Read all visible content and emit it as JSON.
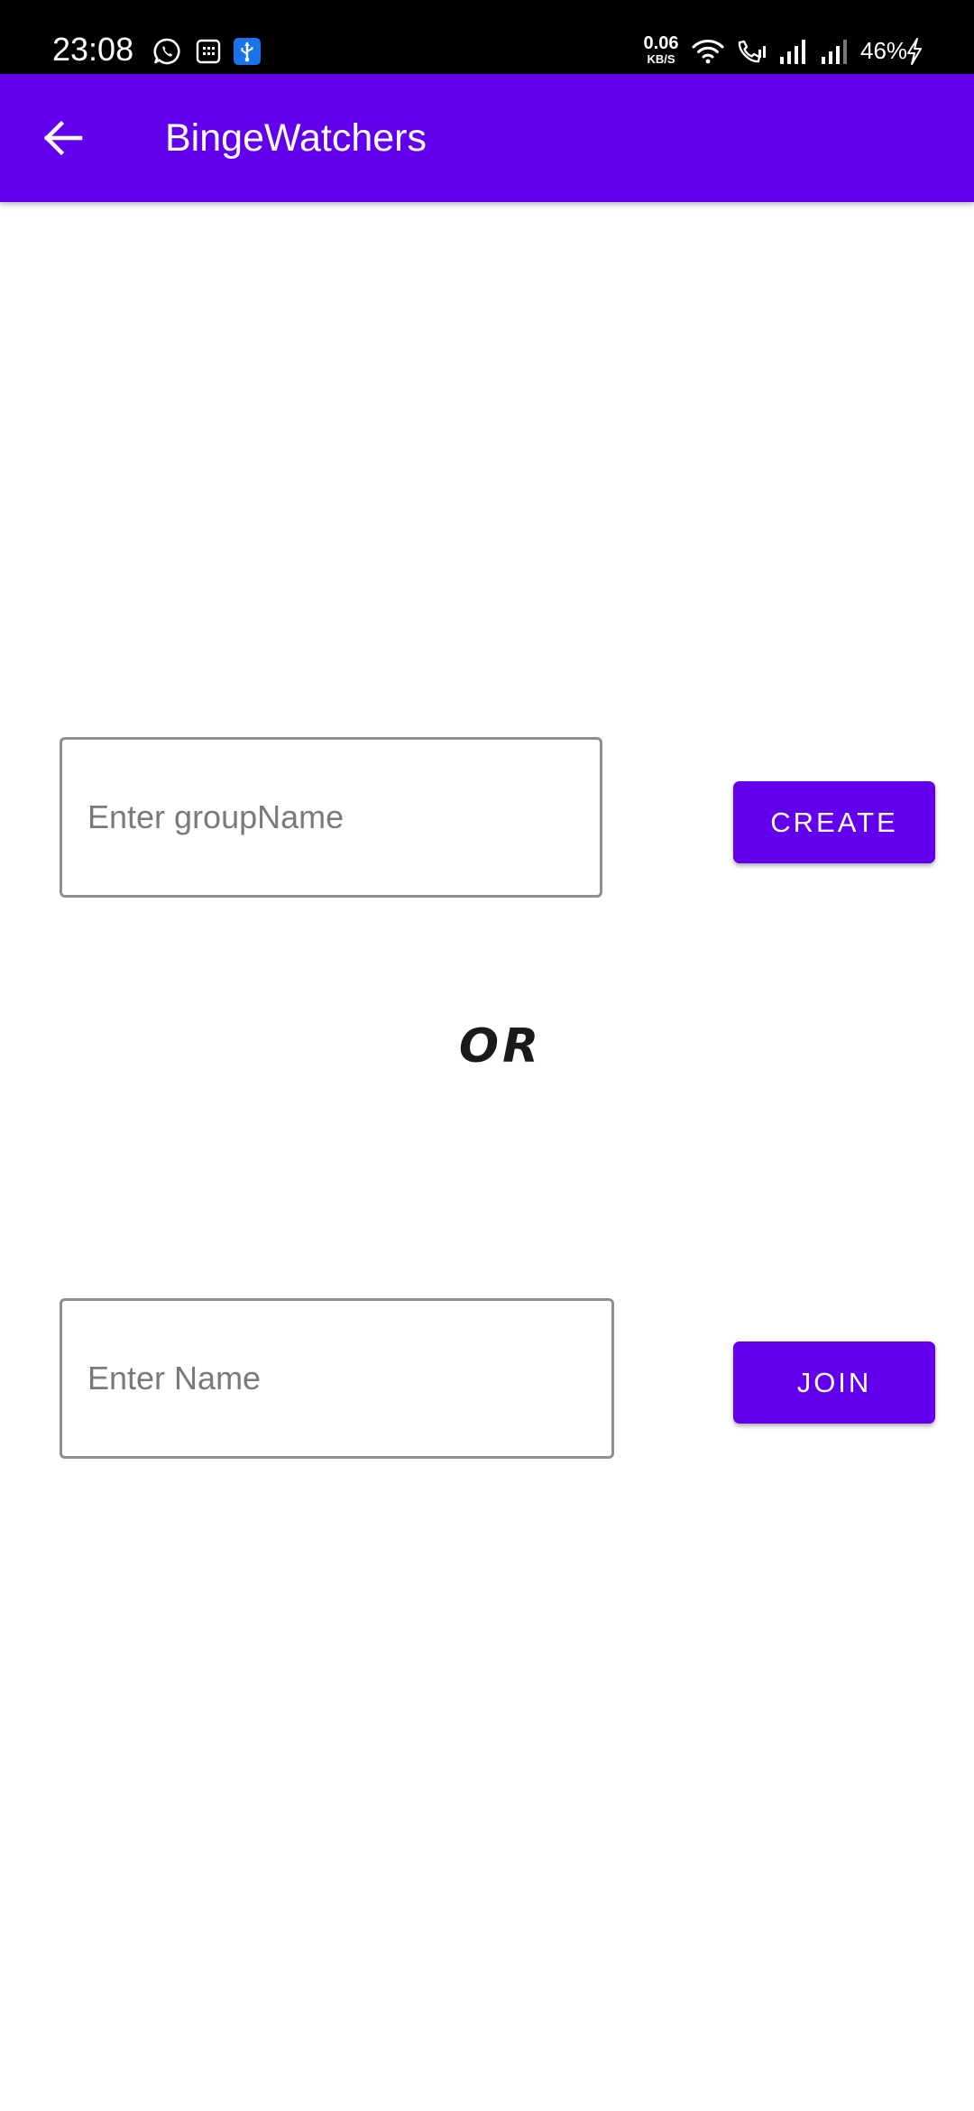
{
  "status_bar": {
    "time": "23:08",
    "left_icons": [
      "whatsapp-icon",
      "calendar-app-icon",
      "usb-icon"
    ],
    "network_speed_value": "0.06",
    "network_speed_unit": "KB/S",
    "right_icons": [
      "wifi-icon",
      "wifi-calling-icon",
      "signal-sim1-icon",
      "signal-sim2-icon"
    ],
    "battery_percent": "46%",
    "battery_charging_icon": "charging-bolt-icon"
  },
  "app_bar": {
    "title": "BingeWatchers",
    "back_icon": "arrow-back-icon",
    "background_color": "#6200ee"
  },
  "create_section": {
    "input_value": "",
    "input_placeholder": "Enter groupName",
    "button_label": "CREATE"
  },
  "divider_text": "OR",
  "join_section": {
    "input_value": "",
    "input_placeholder": "Enter Name",
    "button_label": "JOIN"
  },
  "colors": {
    "primary": "#6200ee",
    "status_bar": "#000000",
    "field_border": "#8e8e8e",
    "placeholder": "#7a7a7a",
    "background": "#ffffff"
  }
}
